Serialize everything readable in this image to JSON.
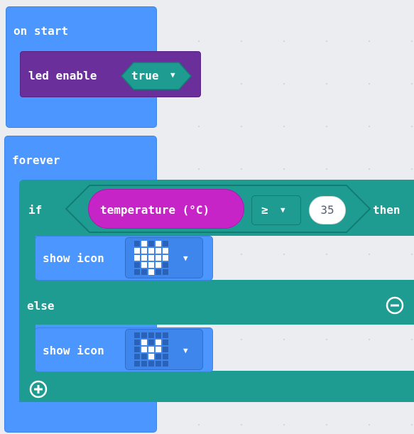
{
  "colors": {
    "event": "#4c97ff",
    "led": "#6a2f9a",
    "logic": "#1e9c91",
    "sensor": "#c724c7",
    "workspace": "#ebedf0"
  },
  "on_start": {
    "label": "on start",
    "led_enable": {
      "label": "led enable",
      "value": "true"
    }
  },
  "forever": {
    "label": "forever",
    "if_block": {
      "if_label": "if",
      "condition": {
        "sensor": "temperature (°C)",
        "operator": "≥",
        "value": "35"
      },
      "then_label": "then",
      "then_stmt": {
        "label": "show icon",
        "icon": "heart"
      },
      "else_label": "else",
      "else_stmt": {
        "label": "show icon",
        "icon": "small-heart"
      }
    }
  }
}
